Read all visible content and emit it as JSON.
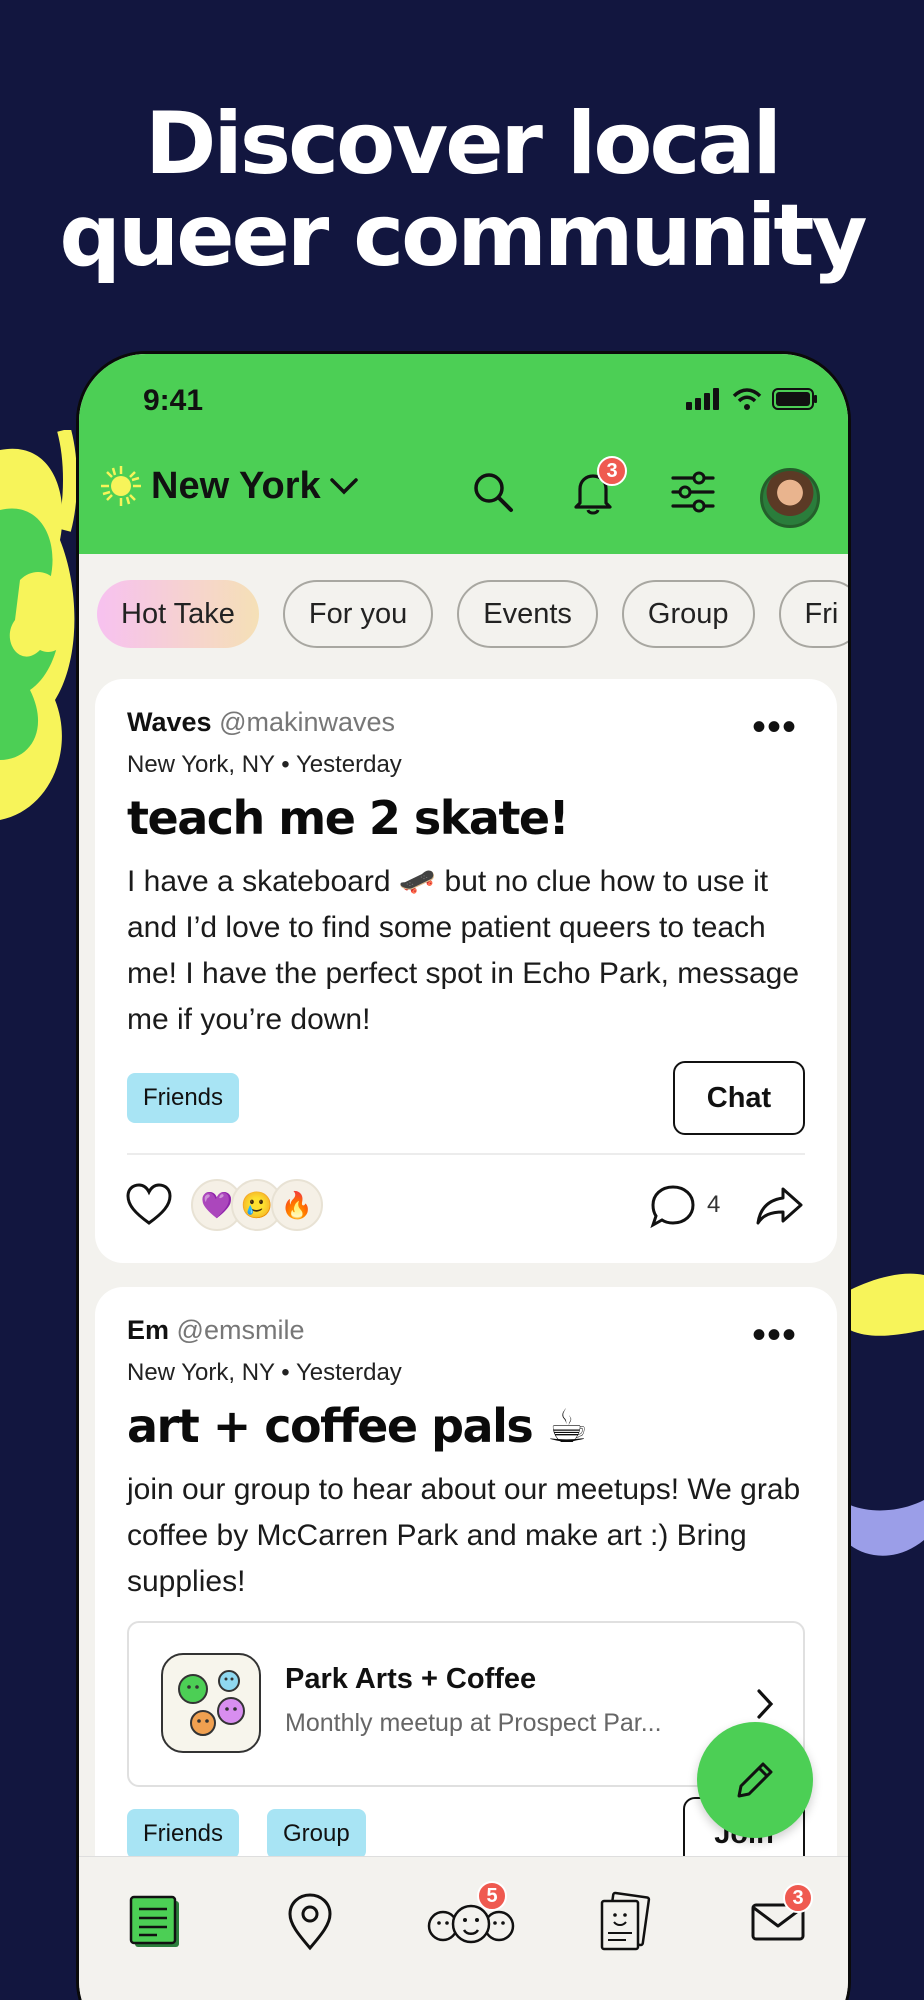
{
  "headline": {
    "line1": "Discover local",
    "line2": "queer community"
  },
  "colors": {
    "background": "#12163f",
    "brand_green": "#4ccf55",
    "badge_red": "#ef5a50",
    "tag_blue": "#a8e4f4"
  },
  "status_bar": {
    "time": "9:41"
  },
  "header": {
    "location": "New York",
    "notification_count": "3",
    "icons": [
      "sun-icon",
      "chevron-down-icon",
      "search-icon",
      "bell-icon",
      "filter-icon",
      "avatar"
    ]
  },
  "chips": [
    "Hot Take",
    "For you",
    "Events",
    "Group",
    "Fri"
  ],
  "posts": [
    {
      "name": "Waves",
      "handle": "@makinwaves",
      "meta": "New York, NY • Yesterday",
      "title": "teach me 2 skate!",
      "body": "I have a skateboard 🛹 but no clue how to use it and I’d love to find some patient queers to teach me! I have the perfect spot in Echo Park, message me if you’re down!",
      "tag": "Friends",
      "action": "Chat",
      "reactions": [
        "💜",
        "🥲",
        "🔥"
      ],
      "comment_count": "4"
    },
    {
      "name": "Em",
      "handle": "@emsmile",
      "meta": "New York, NY • Yesterday",
      "title": "art + coffee pals ☕",
      "body": "join our group to hear about our meetups! We grab coffee by McCarren Park and make art :) Bring supplies!",
      "group": {
        "name": "Park Arts + Coffee",
        "desc": "Monthly meetup at Prospect Par..."
      },
      "tags": [
        "Friends",
        "Group"
      ],
      "action": "Join"
    }
  ],
  "tabbar": {
    "community_badge": "5",
    "inbox_badge": "3"
  }
}
